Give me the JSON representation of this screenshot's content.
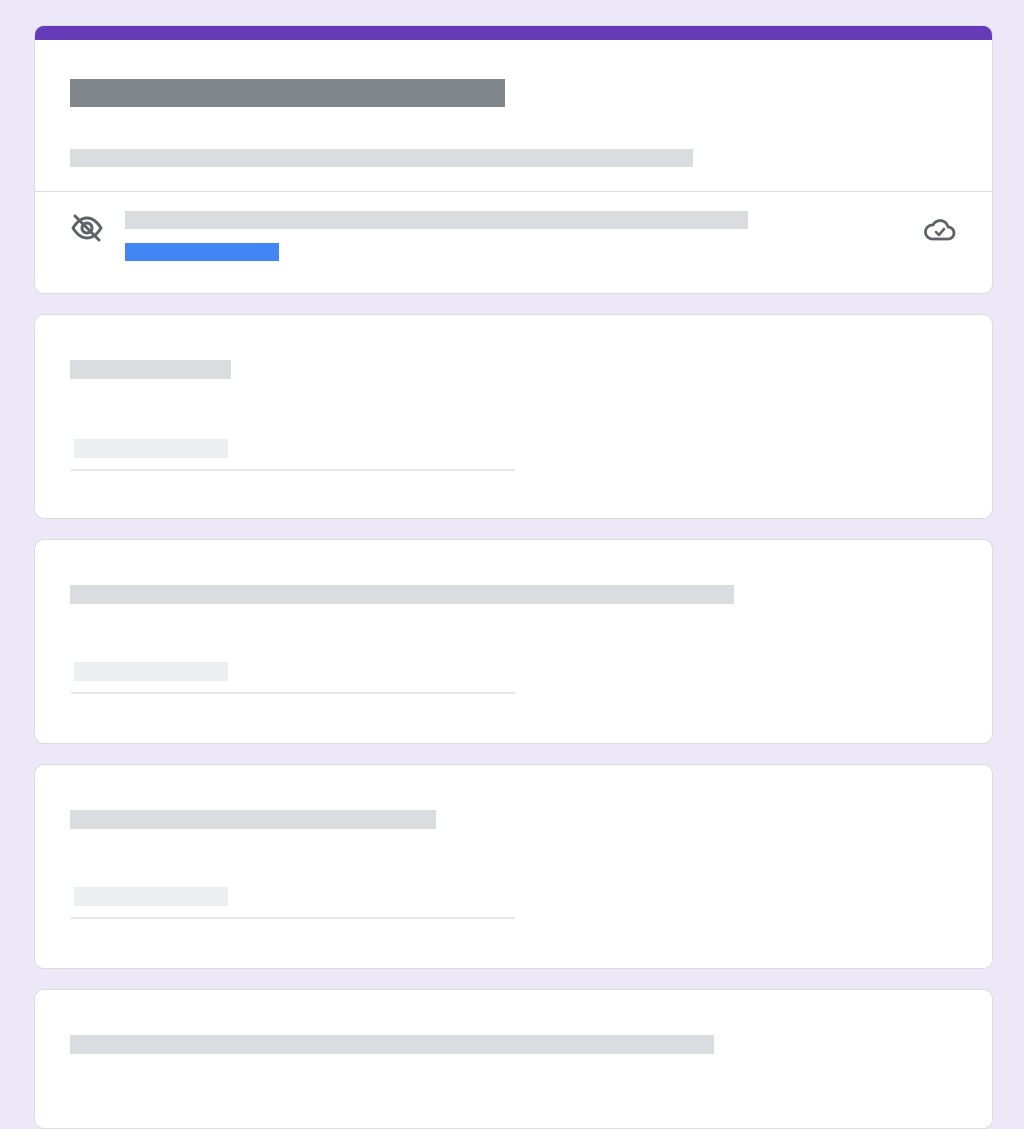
{
  "form": {
    "accent_color": "#673ab7",
    "link_color": "#4285f4",
    "header": {
      "icons": {
        "visibility": "eye-off-icon",
        "saved": "cloud-check-icon"
      }
    },
    "questions": [
      {
        "id": "q1"
      },
      {
        "id": "q2"
      },
      {
        "id": "q3"
      },
      {
        "id": "q4"
      }
    ]
  }
}
